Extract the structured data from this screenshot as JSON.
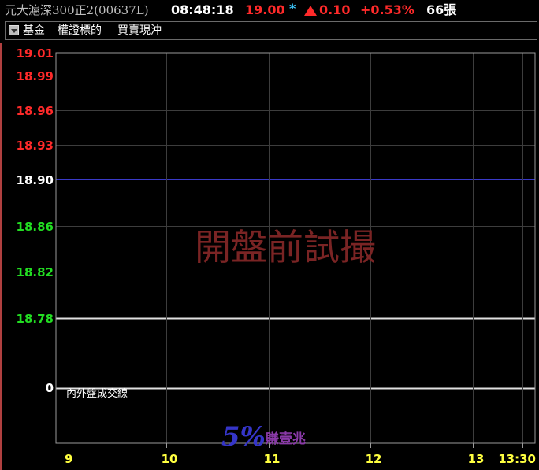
{
  "header": {
    "title": "元大滬深300正2(00637L)",
    "time": "08:48:18",
    "price": "19.00",
    "star": "*",
    "change": "0.10",
    "change_pct": "+0.53%",
    "volume": "66張"
  },
  "tabs": {
    "dropdown_icon": "chevron-down-icon",
    "items": [
      "基金",
      "權證標的",
      "買賣現沖"
    ]
  },
  "chart": {
    "watermark": "開盤前試撮",
    "volume_label": "內外盤成交線",
    "volume_zero": "0",
    "colors": {
      "up": "#ff2a2a",
      "ref": "#ffffff",
      "down": "#22dd22",
      "time": "#ffff40"
    }
  },
  "logo": {
    "num": "5%",
    "text": "賺壹兆"
  },
  "chart_data": {
    "type": "line",
    "ylim": [
      18.78,
      19.01
    ],
    "reference_price": 18.9,
    "y_ticks": [
      "19.01",
      "18.99",
      "18.96",
      "18.93",
      "18.90",
      "18.86",
      "18.82",
      "18.78"
    ],
    "x_ticks": [
      "9",
      "10",
      "11",
      "12",
      "13",
      "13:30"
    ],
    "series": []
  }
}
